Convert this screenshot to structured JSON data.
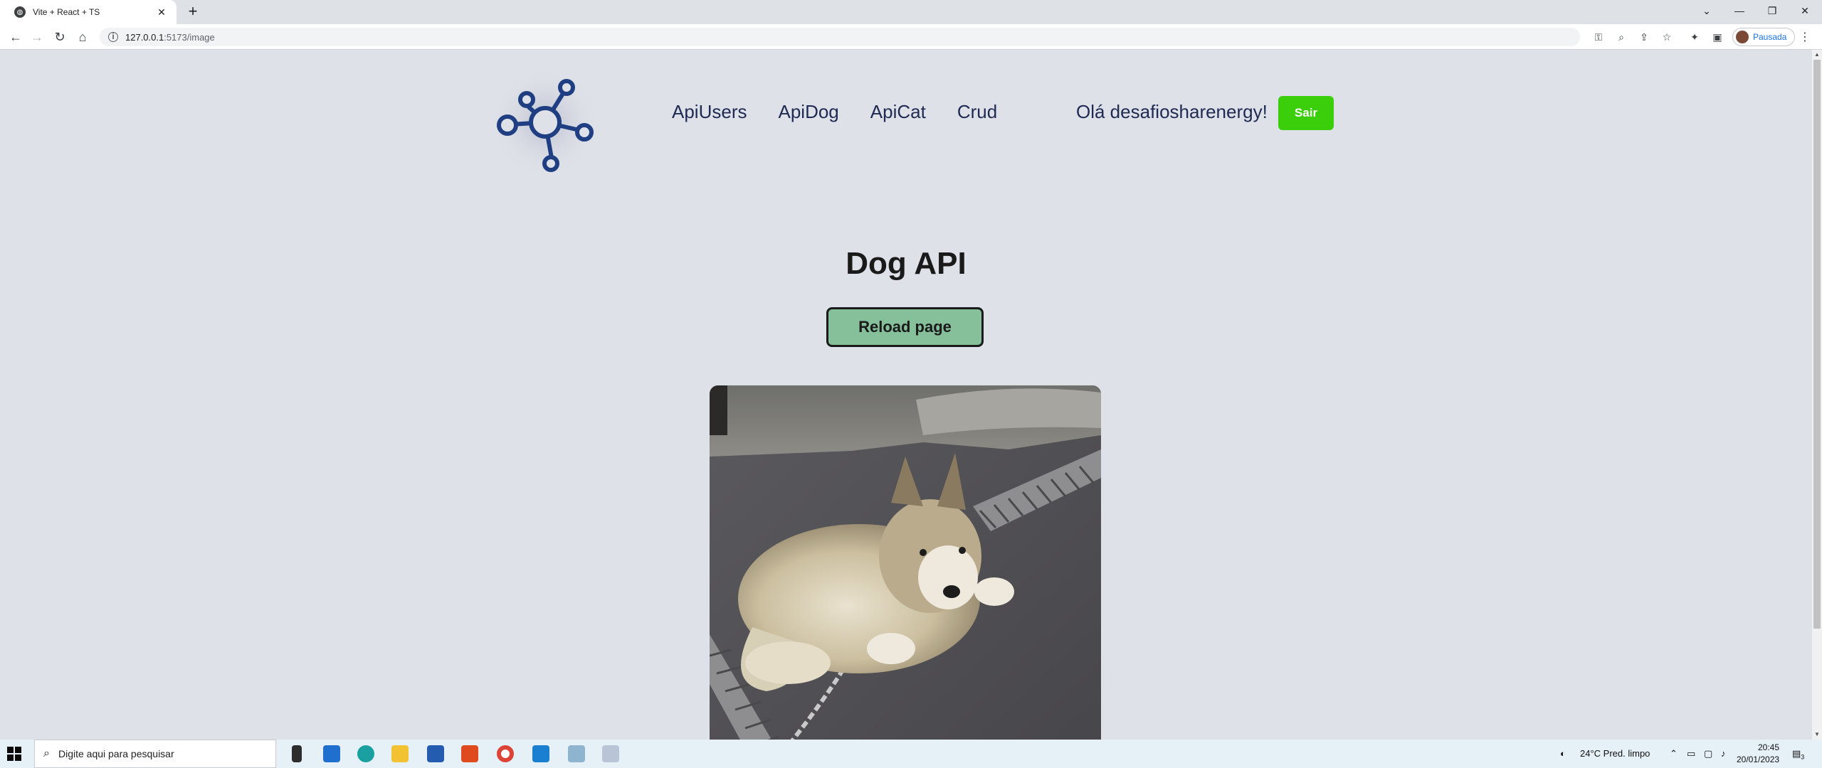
{
  "browser": {
    "tab_title": "Vite + React + TS",
    "tab_close": "✕",
    "new_tab": "+",
    "url_host": "127.0.0.1",
    "url_path": ":5173/image",
    "profile_label": "Pausada",
    "window_controls": {
      "list": "⌄",
      "minimize": "—",
      "restore": "❐",
      "close": "✕"
    }
  },
  "header": {
    "nav": [
      "ApiUsers",
      "ApiDog",
      "ApiCat",
      "Crud"
    ],
    "greeting": "Olá desafiosharenergy!",
    "logout_label": "Sair"
  },
  "main": {
    "title": "Dog API",
    "reload_label": "Reload page",
    "image_subject": "malamute-puppy-photo"
  },
  "taskbar": {
    "search_placeholder": "Digite aqui para pesquisar",
    "weather": "24°C  Pred. limpo",
    "time": "20:45",
    "date": "20/01/2023",
    "notification_count": "3"
  },
  "colors": {
    "page_bg": "#dfe1e8",
    "nav_text": "#1e2a52",
    "logout_bg": "#3bcf0b",
    "reload_bg": "#86c09b",
    "logo_stroke": "#1f3f82"
  }
}
